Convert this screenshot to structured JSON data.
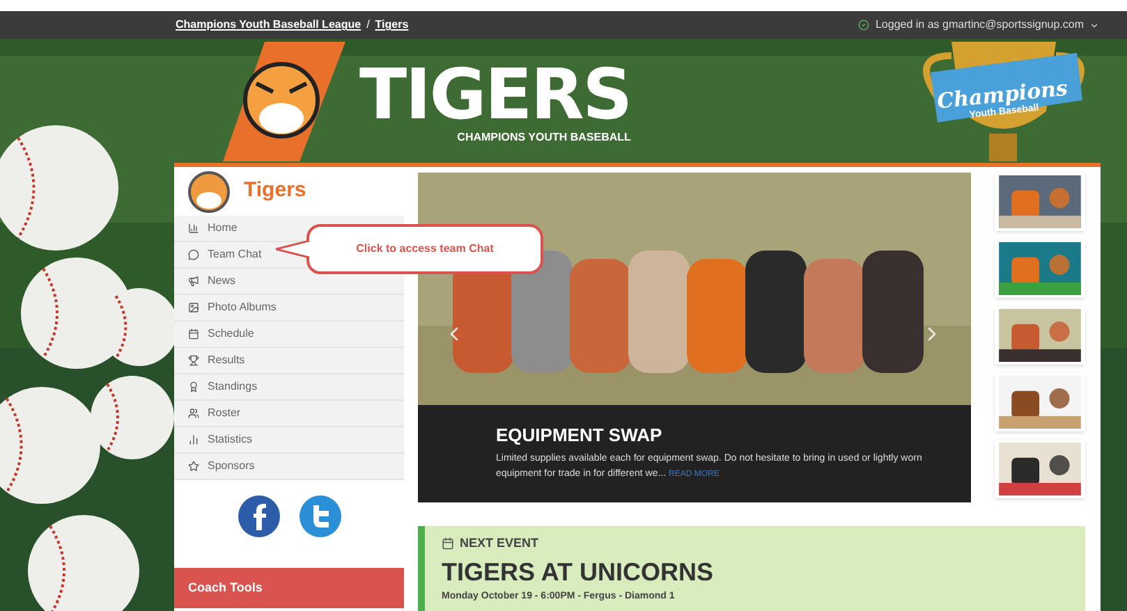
{
  "top_bar": {
    "breadcrumb": [
      {
        "label": "Champions Youth Baseball League"
      },
      {
        "label": "Tigers"
      }
    ],
    "separator": "/",
    "account": "Logged in as gmartinc@sportssignup.com"
  },
  "banner": {
    "title": "TIGERS",
    "subtitle": "CHAMPIONS YOUTH BASEBALL",
    "trophy_text": [
      "Champions",
      "Youth Baseball"
    ]
  },
  "sidebar": {
    "team_name": "Tigers",
    "items": [
      {
        "label": "Home"
      },
      {
        "label": "Team Chat"
      },
      {
        "label": "News"
      },
      {
        "label": "Photo Albums"
      },
      {
        "label": "Schedule"
      },
      {
        "label": "Results"
      },
      {
        "label": "Standings"
      },
      {
        "label": "Roster"
      },
      {
        "label": "Statistics"
      },
      {
        "label": "Sponsors"
      }
    ],
    "section": "Coach Tools"
  },
  "callout": "Click to access team Chat",
  "carousel": {
    "title": "EQUIPMENT SWAP",
    "text": "Limited supplies available each for equipment swap. Do not hesitate to bring in used or lightly worn equipment for trade in for different we...",
    "link": "READ MORE"
  },
  "next_event": {
    "label": "NEXT EVENT",
    "title": "TIGERS AT UNICORNS",
    "details": "Monday October 19 - 6:00PM - Fergus - Diamond 1"
  }
}
